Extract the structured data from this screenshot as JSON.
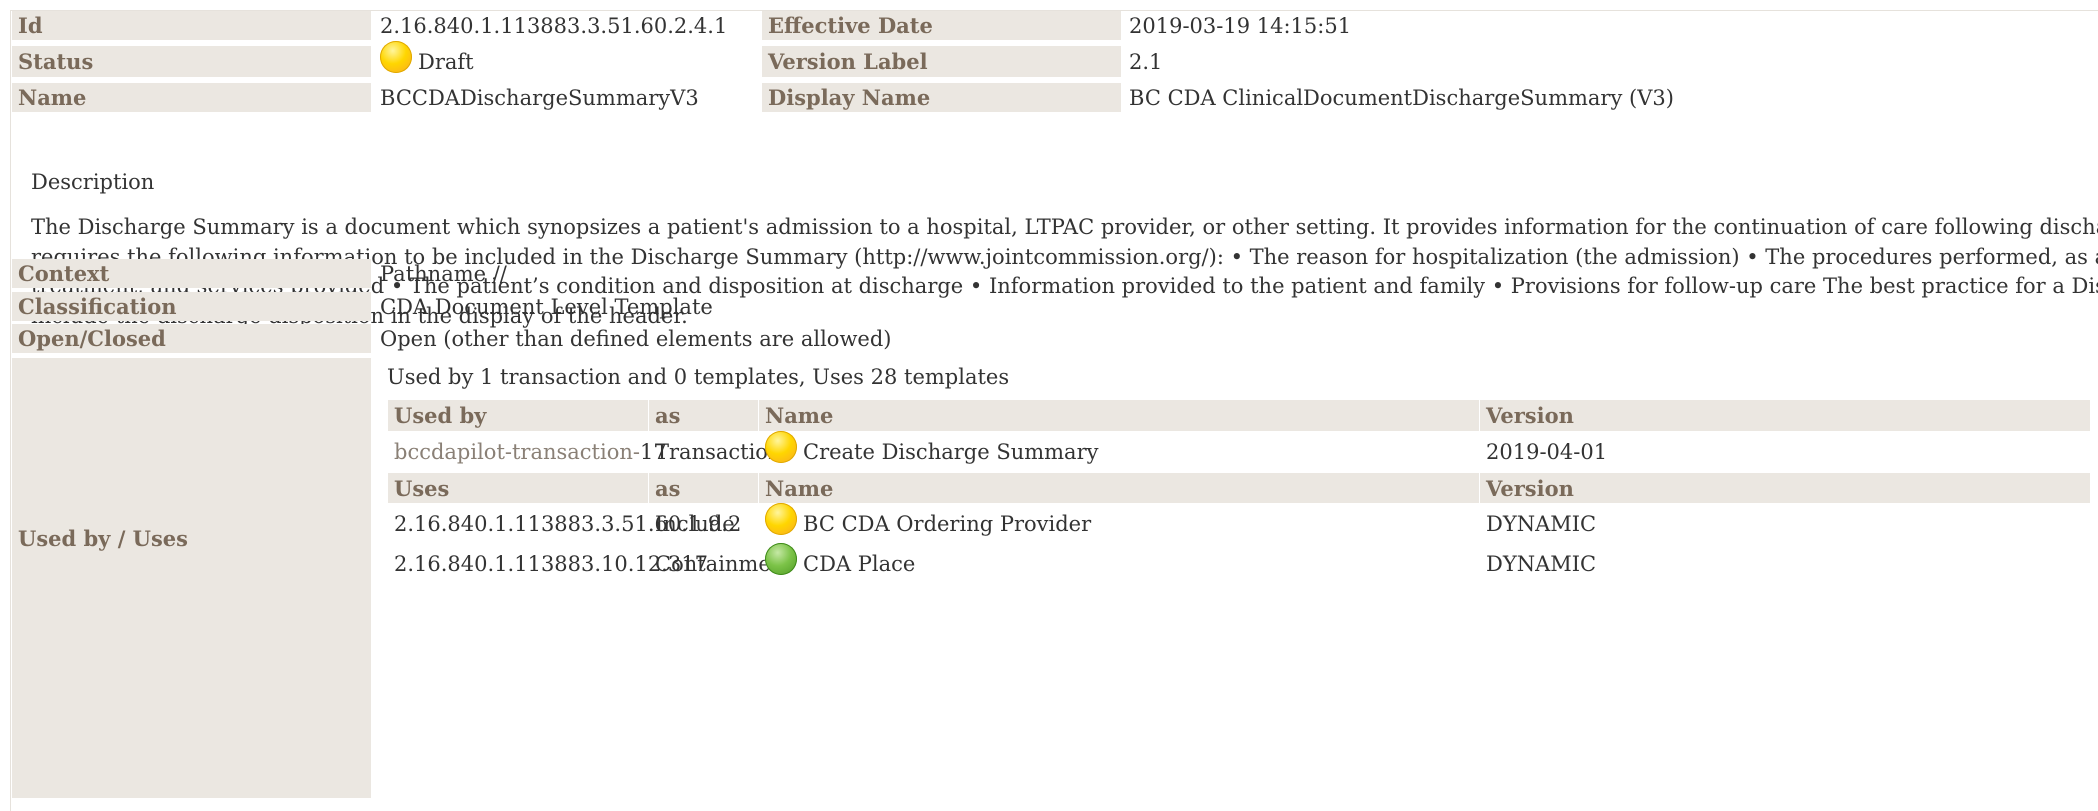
{
  "meta": {
    "id_label": "Id",
    "id_value": "2.16.840.1.113883.3.51.60.2.4.1",
    "effective_date_label": "Effective Date",
    "effective_date_value": "2019-03-19 14:15:51",
    "status_label": "Status",
    "status_value": "Draft",
    "status_icon": "yellow-circle-icon",
    "version_label_label": "Version Label",
    "version_label_value": "2.1",
    "name_label": "Name",
    "name_value": "BCCDADischargeSummaryV3",
    "display_name_label": "Display Name",
    "display_name_value": "BC CDA ClinicalDocumentDischargeSummary (V3)"
  },
  "description": {
    "title": "Description",
    "lines": [
      "The Discharge Summary is a document which synopsizes a patient's admission to a hospital, LTPAC provider, or other setting. It provides information for the continuation of care following discharge. The J",
      "requires the following information to be included in the Discharge Summary (http://www.jointcommission.org/): • The reason for hospitalization (the admission) • The procedures performed, as applicab",
      "treatment, and services provided • The patient’s condition and disposition at discharge • Information provided to the patient and family • Provisions for follow-up care The best practice for a Discharge Su",
      "include the discharge disposition in the display of the header."
    ]
  },
  "details": {
    "context_label": "Context",
    "context_value": "Pathname //",
    "classification_label": "Classification",
    "classification_value": "CDA Document Level Template",
    "open_closed_label": "Open/Closed",
    "open_closed_value": "Open (other than defined elements are allowed)",
    "used_by_uses_label": "Used by / Uses"
  },
  "usage": {
    "summary": "Used by 1 transaction and 0 templates, Uses 28 templates",
    "used_by_headers": [
      "Used by",
      "as",
      "Name",
      "Version"
    ],
    "used_by_rows": [
      {
        "id_prefix": "bccdapilot-transaction-",
        "id_suffix": "17",
        "as": "Transaction",
        "icon": "yellow-circle-icon",
        "name": "Create Discharge Summary",
        "version": "2019-04-01"
      }
    ],
    "uses_headers": [
      "Uses",
      "as",
      "Name",
      "Version"
    ],
    "uses_rows": [
      {
        "id": "2.16.840.1.113883.3.51.60.1.9.2",
        "as": "Include",
        "icon": "yellow-circle-icon",
        "name": "BC CDA Ordering Provider",
        "version": "DYNAMIC"
      },
      {
        "id": "2.16.840.1.113883.10.12.317",
        "as": "Containment",
        "icon": "green-circle-icon",
        "name": "CDA Place",
        "version": "DYNAMIC"
      }
    ]
  }
}
